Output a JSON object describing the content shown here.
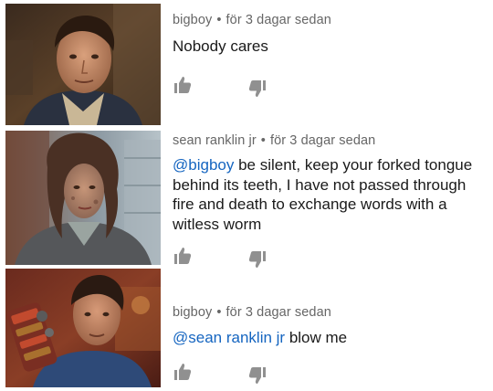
{
  "comments": [
    {
      "author": "bigboy",
      "separator": "•",
      "time": "för 3 dagar sedan",
      "mention": "",
      "text": "Nobody cares",
      "like_icon": "thumbs-up-icon",
      "dislike_icon": "thumbs-down-icon",
      "avatar_icon": "man-portrait"
    },
    {
      "author": "sean ranklin jr",
      "separator": "•",
      "time": "för 3 dagar sedan",
      "mention": "@bigboy",
      "text": " be silent, keep your forked tongue behind its teeth, I have not passed through fire and death to exchange words with a witless worm",
      "like_icon": "thumbs-up-icon",
      "dislike_icon": "thumbs-down-icon",
      "avatar_icon": "woman-portrait"
    },
    {
      "author": "bigboy",
      "separator": "•",
      "time": "för 3 dagar sedan",
      "mention": "@sean ranklin jr",
      "text": " blow me",
      "like_icon": "thumbs-up-icon",
      "dislike_icon": "thumbs-down-icon",
      "avatar_icon": "man-with-gauntlet-portrait"
    }
  ],
  "colors": {
    "meta": "#666666",
    "text": "#1a1a1a",
    "mention": "#1565c0",
    "icon": "#909090"
  }
}
